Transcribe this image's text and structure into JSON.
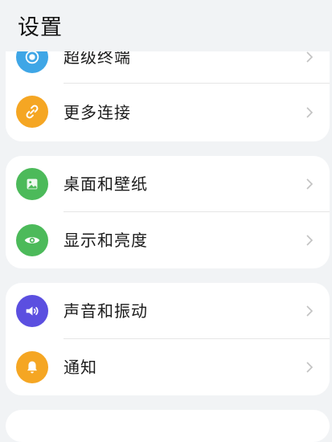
{
  "header": {
    "title": "设置"
  },
  "groups": [
    {
      "items": [
        {
          "label": "超级终端",
          "icon": "super-device-icon",
          "color": "#3fa6e6"
        },
        {
          "label": "更多连接",
          "icon": "link-icon",
          "color": "#f5a623"
        }
      ]
    },
    {
      "items": [
        {
          "label": "桌面和壁纸",
          "icon": "wallpaper-icon",
          "color": "#4cba5a"
        },
        {
          "label": "显示和亮度",
          "icon": "eye-icon",
          "color": "#4cba5a"
        }
      ]
    },
    {
      "items": [
        {
          "label": "声音和振动",
          "icon": "speaker-icon",
          "color": "#5b4fe0"
        },
        {
          "label": "通知",
          "icon": "bell-icon",
          "color": "#f5a623"
        }
      ]
    }
  ]
}
